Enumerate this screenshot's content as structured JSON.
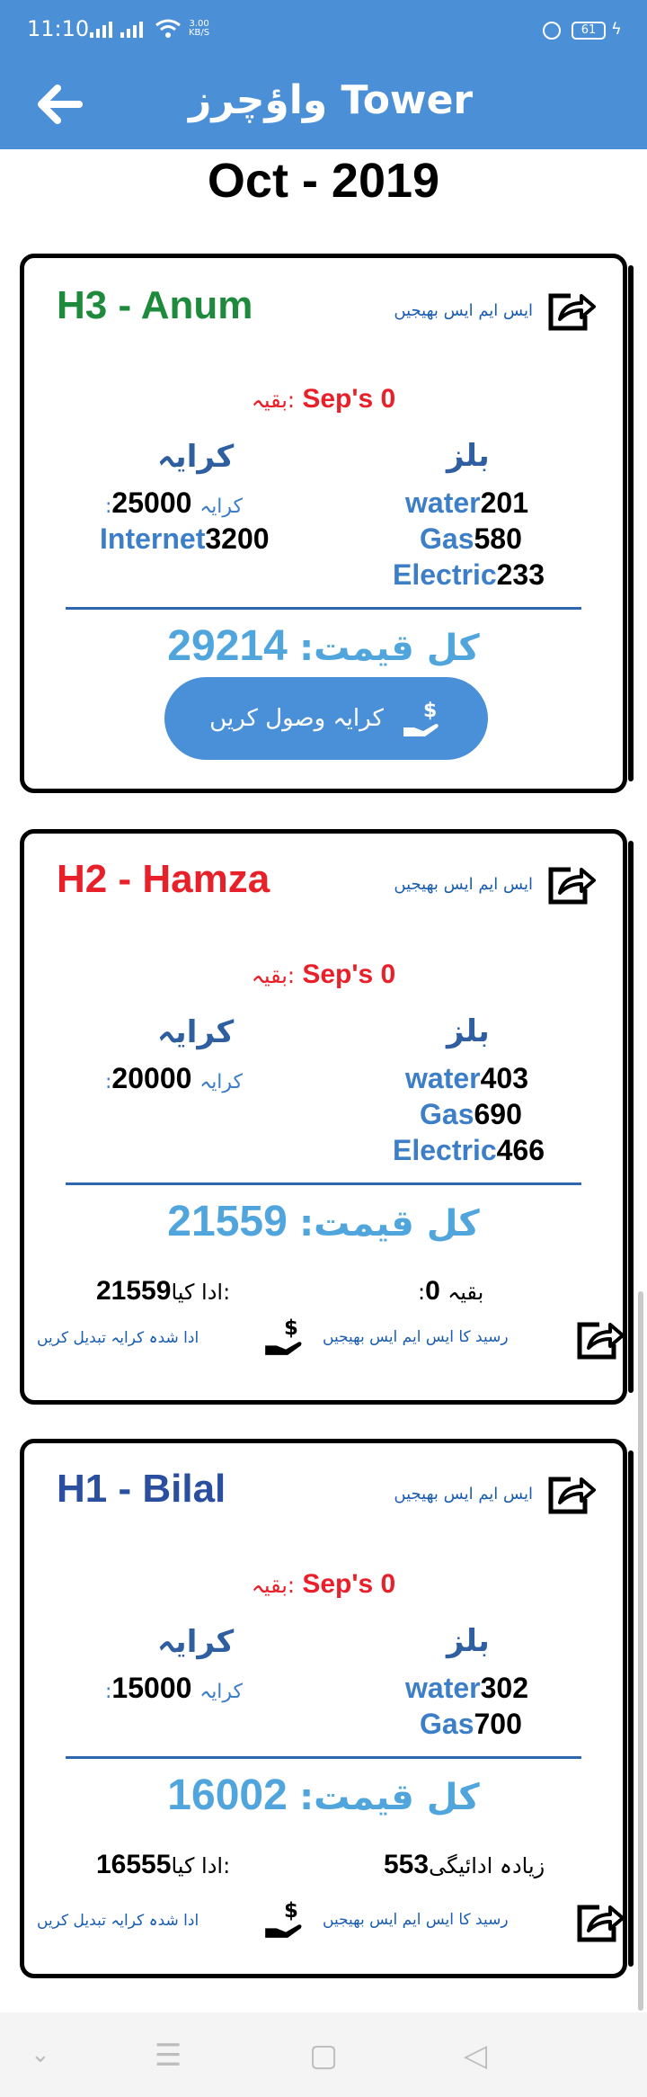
{
  "status_bar": {
    "time": "11:10",
    "speed_value": "3.00",
    "speed_unit": "KB/S",
    "battery": "61"
  },
  "app_bar": {
    "title": "واؤچرز Tower",
    "color": "#4b8fd6"
  },
  "month_label": "Oct - 2019",
  "labels": {
    "send_sms": "ایس ایم ایس بھیجیں",
    "balance_prefix": "بقیہ:",
    "rent_header": "کرایہ",
    "bills_header": "بلز",
    "rent_label": ":کرایہ",
    "internet_label": "Internet",
    "water_label": "water",
    "gas_label": "Gas",
    "electric_label": "Electric",
    "total_label": "کل قیمت:",
    "collect_rent": "کرایہ وصول کریں",
    "receipt_sms": "رسید کا ایس ایم ایس بھیجیں",
    "change_paid_rent": "ادا شدہ کرایہ تبدیل کریں",
    "remaining_label": ":بقیہ",
    "paid_label": "ادا کیا:",
    "extra_paid_label": "زیادہ ادائیگی"
  },
  "cards": [
    {
      "name": "H3 - Anum",
      "name_color": "#1e8a3c",
      "prev_balance": "Sep's 0",
      "rent": "25000",
      "internet": "3200",
      "water": "201",
      "gas": "580",
      "electric": "233",
      "total": "29214"
    },
    {
      "name": "H2 - Hamza",
      "name_color": "#e8202a",
      "prev_balance": "Sep's 0",
      "rent": "20000",
      "water": "403",
      "gas": "690",
      "electric": "466",
      "total": "21559",
      "remaining": "0",
      "paid": "21559"
    },
    {
      "name": "H1 - Bilal",
      "name_color": "#2a4f9e",
      "prev_balance": "Sep's 0",
      "rent": "15000",
      "water": "302",
      "gas": "700",
      "total": "16002",
      "extra_paid": "553",
      "paid": "16555"
    }
  ]
}
